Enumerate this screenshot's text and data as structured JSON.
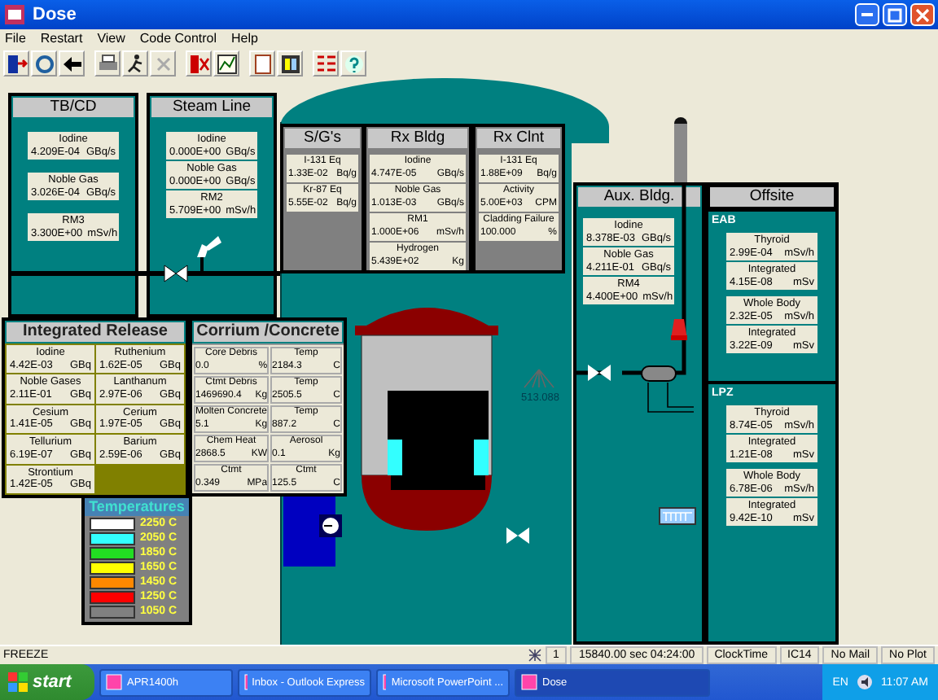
{
  "window": {
    "title": "Dose"
  },
  "menu": [
    "File",
    "Restart",
    "View",
    "Code Control",
    "Help"
  ],
  "tb_cd": {
    "title": "TB/CD",
    "readings": [
      {
        "label": "Iodine",
        "value": "4.209E-04",
        "unit": "GBq/s"
      },
      {
        "label": "Noble Gas",
        "value": "3.026E-04",
        "unit": "GBq/s"
      },
      {
        "label": "RM3",
        "value": "3.300E+00",
        "unit": "mSv/h"
      }
    ]
  },
  "steam_line": {
    "title": "Steam Line",
    "readings": [
      {
        "label": "Iodine",
        "value": "0.000E+00",
        "unit": "GBq/s"
      },
      {
        "label": "Noble Gas",
        "value": "0.000E+00",
        "unit": "GBq/s"
      },
      {
        "label": "RM2",
        "value": "5.709E+00",
        "unit": "mSv/h"
      }
    ]
  },
  "sgs": {
    "title": "S/G's",
    "readings": [
      {
        "label": "I-131 Eq",
        "value": "1.33E-02",
        "unit": "Bq/g"
      },
      {
        "label": "Kr-87 Eq",
        "value": "5.55E-02",
        "unit": "Bq/g"
      }
    ]
  },
  "rx_bldg": {
    "title": "Rx Bldg",
    "readings": [
      {
        "label": "Iodine",
        "value": "4.747E-05",
        "unit": "GBq/s"
      },
      {
        "label": "Noble Gas",
        "value": "1.013E-03",
        "unit": "GBq/s"
      },
      {
        "label": "RM1",
        "value": "1.000E+06",
        "unit": "mSv/h"
      },
      {
        "label": "Hydrogen",
        "value": "5.439E+02",
        "unit": "Kg"
      }
    ]
  },
  "rx_clnt": {
    "title": "Rx Clnt",
    "readings": [
      {
        "label": "I-131 Eq",
        "value": "1.88E+09",
        "unit": "Bq/g"
      },
      {
        "label": "Activity",
        "value": "5.00E+03",
        "unit": "CPM"
      },
      {
        "label": "Cladding Failure",
        "value": "100.000",
        "unit": "%"
      }
    ]
  },
  "aux_bldg": {
    "title": "Aux. Bldg.",
    "readings": [
      {
        "label": "Iodine",
        "value": "8.378E-03",
        "unit": "GBq/s"
      },
      {
        "label": "Noble Gas",
        "value": "4.211E-01",
        "unit": "GBq/s"
      },
      {
        "label": "RM4",
        "value": "4.400E+00",
        "unit": "mSv/h"
      }
    ]
  },
  "offsite": {
    "title": "Offsite",
    "sections": [
      {
        "label": "EAB",
        "groups": [
          {
            "readings": [
              {
                "label": "Thyroid",
                "value": "2.99E-04",
                "unit": "mSv/h"
              },
              {
                "label": "Integrated",
                "value": "4.15E-08",
                "unit": "mSv"
              }
            ]
          },
          {
            "readings": [
              {
                "label": "Whole Body",
                "value": "2.32E-05",
                "unit": "mSv/h"
              },
              {
                "label": "Integrated",
                "value": "3.22E-09",
                "unit": "mSv"
              }
            ]
          }
        ]
      },
      {
        "label": "LPZ",
        "groups": [
          {
            "readings": [
              {
                "label": "Thyroid",
                "value": "8.74E-05",
                "unit": "mSv/h"
              },
              {
                "label": "Integrated",
                "value": "1.21E-08",
                "unit": "mSv"
              }
            ]
          },
          {
            "readings": [
              {
                "label": "Whole Body",
                "value": "6.78E-06",
                "unit": "mSv/h"
              },
              {
                "label": "Integrated",
                "value": "9.42E-10",
                "unit": "mSv"
              }
            ]
          }
        ]
      }
    ]
  },
  "integrated_release": {
    "title": "Integrated Release",
    "readings": [
      {
        "label": "Iodine",
        "value": "4.42E-03",
        "unit": "GBq"
      },
      {
        "label": "Ruthenium",
        "value": "1.62E-05",
        "unit": "GBq"
      },
      {
        "label": "Noble Gases",
        "value": "2.11E-01",
        "unit": "GBq"
      },
      {
        "label": "Lanthanum",
        "value": "2.97E-06",
        "unit": "GBq"
      },
      {
        "label": "Cesium",
        "value": "1.41E-05",
        "unit": "GBq"
      },
      {
        "label": "Cerium",
        "value": "1.97E-05",
        "unit": "GBq"
      },
      {
        "label": "Tellurium",
        "value": "6.19E-07",
        "unit": "GBq"
      },
      {
        "label": "Barium",
        "value": "2.59E-06",
        "unit": "GBq"
      },
      {
        "label": "Strontium",
        "value": "1.42E-05",
        "unit": "GBq"
      }
    ]
  },
  "corium_concrete": {
    "title": "Corrium /Concrete",
    "readings": [
      {
        "label": "Core Debris",
        "value": "0.0",
        "unit": "%"
      },
      {
        "label": "Temp",
        "value": "2184.3",
        "unit": "C"
      },
      {
        "label": "Ctmt Debris",
        "value": "1469690.4",
        "unit": "Kg"
      },
      {
        "label": "Temp",
        "value": "2505.5",
        "unit": "C"
      },
      {
        "label": "Molten Concrete",
        "value": "5.1",
        "unit": "Kg"
      },
      {
        "label": "Temp",
        "value": "887.2",
        "unit": "C"
      },
      {
        "label": "Chem Heat",
        "value": "2868.5",
        "unit": "KW"
      },
      {
        "label": "Aerosol",
        "value": "0.1",
        "unit": "Kg"
      },
      {
        "label": "Ctmt",
        "value": "0.349",
        "unit": "MPa"
      },
      {
        "label": "Ctmt",
        "value": "125.5",
        "unit": "C"
      }
    ]
  },
  "temperatures": {
    "title": "Temperatures",
    "items": [
      {
        "label": "2250 C",
        "color": "#ffffff"
      },
      {
        "label": "2050 C",
        "color": "#33ffff"
      },
      {
        "label": "1850 C",
        "color": "#22dd22"
      },
      {
        "label": "1650 C",
        "color": "#ffff00"
      },
      {
        "label": "1450 C",
        "color": "#ff8800"
      },
      {
        "label": "1250 C",
        "color": "#ff0000"
      },
      {
        "label": "1050 C",
        "color": "#808080"
      }
    ]
  },
  "dose_gauge": {
    "reading": "513.088"
  },
  "status_bar": {
    "mode": "FREEZE",
    "fields": [
      "1",
      "15840.00 sec  04:24:00",
      "ClockTime",
      "IC14",
      "No Mail",
      "No Plot"
    ]
  },
  "taskbar": {
    "start": "start",
    "tasks": [
      {
        "label": "APR1400h",
        "selected": false
      },
      {
        "label": "Inbox - Outlook Express",
        "selected": false
      },
      {
        "label": "Microsoft PowerPoint ...",
        "selected": false
      },
      {
        "label": "Dose",
        "selected": true
      }
    ],
    "language": "EN",
    "clock": "11:07 AM"
  }
}
